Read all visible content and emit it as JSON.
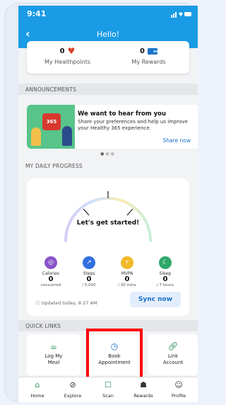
{
  "status_bar": {
    "time": "9:41"
  },
  "app_bar": {
    "back_icon": "chevron-left-icon",
    "title": "Hello!"
  },
  "points": {
    "healthpoints": {
      "value": "0",
      "label": "My Healthpoints"
    },
    "rewards": {
      "value": "0",
      "label": "My Rewards"
    }
  },
  "announcements": {
    "section_label": "ANNOUNCEMENTS",
    "calendar_text": "365",
    "title": "We want to hear from you",
    "text": "Share your preferences and help us improve your Healthy 365 experience.",
    "link": "Share now"
  },
  "daily_progress": {
    "section_label": "MY DAILY PROGRESS",
    "gauge_text": "Let's get started!",
    "metrics": [
      {
        "name": "Calories",
        "value": "0",
        "unit": "consumed",
        "color": "#8a54c8",
        "icon": "plate-icon"
      },
      {
        "name": "Steps",
        "value": "0",
        "unit": "/ 5,000",
        "color": "#2f6fe0",
        "icon": "steps-icon"
      },
      {
        "name": "MVPA",
        "value": "0",
        "unit": "/ 30 mins",
        "color": "#f2b92a",
        "icon": "lightning-icon"
      },
      {
        "name": "Sleep",
        "value": "0",
        "unit": "/ 7 hours",
        "color": "#2fa86a",
        "icon": "moon-icon"
      }
    ],
    "updated": "Updated today, 8:27 AM",
    "sync_label": "Sync now"
  },
  "quick_links": {
    "section_label": "QUICK LINKS",
    "items": [
      {
        "label1": "Log My",
        "label2": "Meal",
        "icon": "meal-icon"
      },
      {
        "label1": "Book",
        "label2": "Appointment",
        "icon": "clock-icon"
      },
      {
        "label1": "Link",
        "label2": "Account",
        "icon": "link-icon"
      }
    ]
  },
  "tabs": [
    {
      "label": "Home",
      "icon": "home-icon"
    },
    {
      "label": "Explore",
      "icon": "compass-icon"
    },
    {
      "label": "Scan",
      "icon": "scan-icon"
    },
    {
      "label": "Rewards",
      "icon": "gift-icon"
    },
    {
      "label": "Profile",
      "icon": "profile-icon"
    }
  ],
  "colors": {
    "primary": "#1a9be6",
    "highlight": "#ff0000",
    "accent_green": "#2c8f5a"
  }
}
